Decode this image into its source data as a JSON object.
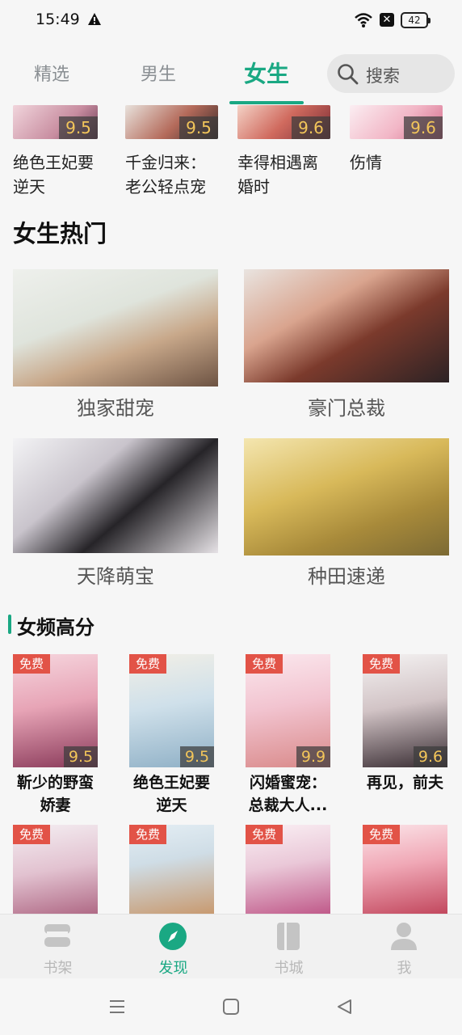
{
  "status_bar": {
    "time": "15:49",
    "battery": "42"
  },
  "tabs": [
    {
      "label": "精选",
      "active": false
    },
    {
      "label": "男生",
      "active": false
    },
    {
      "label": "女生",
      "active": true
    }
  ],
  "search": {
    "placeholder": "搜索"
  },
  "top_row": [
    {
      "title_line1": "绝色王妃要",
      "title_line2": "逆天",
      "score": "9.5"
    },
    {
      "title_line1": "千金归来：",
      "title_line2": "老公轻点宠",
      "score": "9.5"
    },
    {
      "title_line1": "幸得相遇离",
      "title_line2": "婚时",
      "score": "9.6"
    },
    {
      "title_line1": "伤情",
      "title_line2": "",
      "score": "9.6"
    }
  ],
  "hot_section": {
    "title": "女生热门",
    "categories": [
      "独家甜宠",
      "豪门总裁",
      "天降萌宝",
      "种田速递"
    ]
  },
  "high_score_section": {
    "title": "女频高分",
    "free_badge": "免费",
    "books": [
      {
        "title_line1": "靳少的野蛮",
        "title_line2": "娇妻",
        "score": "9.5"
      },
      {
        "title_line1": "绝色王妃要",
        "title_line2": "逆天",
        "score": "9.5"
      },
      {
        "title_line1": "闪婚蜜宠：",
        "title_line2": "总裁大人...",
        "score": "9.9"
      },
      {
        "title_line1": "再见，前夫",
        "title_line2": "",
        "score": "9.6"
      }
    ],
    "row2_count": 4
  },
  "bottom_nav": [
    {
      "label": "书架",
      "icon": "bookshelf-icon",
      "active": false
    },
    {
      "label": "发现",
      "icon": "compass-icon",
      "active": true
    },
    {
      "label": "书城",
      "icon": "book-city-icon",
      "active": false
    },
    {
      "label": "我",
      "icon": "user-icon",
      "active": false
    }
  ],
  "colors": {
    "accent": "#1aa883",
    "score": "#f2c55a",
    "free": "#e25347"
  }
}
